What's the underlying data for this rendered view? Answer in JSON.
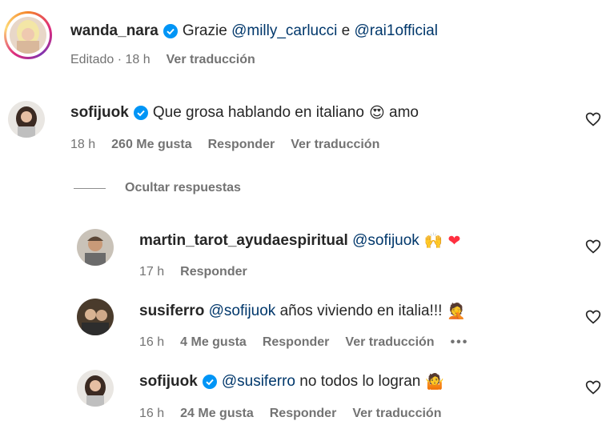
{
  "post": {
    "username": "wanda_nara",
    "text_prefix": "Grazie",
    "mention1": "@milly_carlucci",
    "text_mid": "e",
    "mention2": "@rai1official",
    "meta_time": "Editado · 18 h",
    "meta_translate": "Ver traducción"
  },
  "comment": {
    "username": "sofijuok",
    "text": "Que grosa hablando en italiano",
    "emoji": "😍",
    "text_after": "amo",
    "time": "18 h",
    "likes": "260 Me gusta",
    "reply": "Responder",
    "translate": "Ver traducción"
  },
  "hide_replies": "Ocultar respuestas",
  "replies": [
    {
      "username": "martin_tarot_ayudaespiritual",
      "mention": "@sofijuok",
      "text": "",
      "emoji": "🙌 ❤",
      "time": "17 h",
      "reply": "Responder"
    },
    {
      "username": "susiferro",
      "mention": "@sofijuok",
      "text": "años viviendo en italia!!!",
      "emoji": "🤦",
      "time": "16 h",
      "likes": "4 Me gusta",
      "reply": "Responder",
      "translate": "Ver traducción",
      "more": "•••"
    },
    {
      "username": "sofijuok",
      "mention": "@susiferro",
      "text": "no todos lo logran",
      "emoji": "🤷",
      "time": "16 h",
      "likes": "24 Me gusta",
      "reply": "Responder",
      "translate": "Ver traducción"
    }
  ],
  "colors": {
    "verified": "#0095f6",
    "mention": "#00376b",
    "meta": "#737373",
    "heart_red": "#ff3040"
  }
}
